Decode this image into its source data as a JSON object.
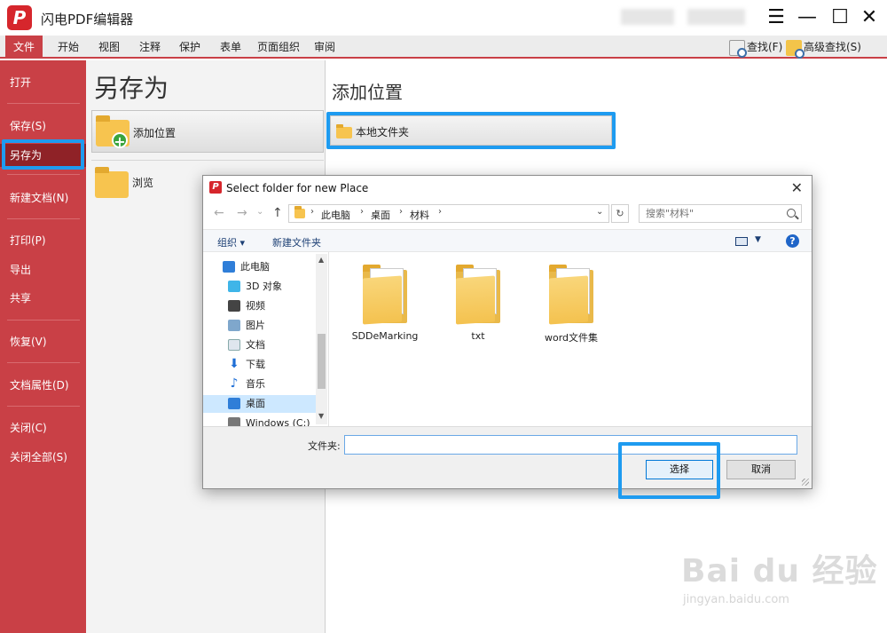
{
  "app": {
    "logo_char": "P",
    "title": "闪电PDF编辑器",
    "accent": "#c94046",
    "highlight": "#1e9bf0"
  },
  "window_controls": {
    "menu_icon": "hamburger-icon",
    "min_glyph": "—",
    "max_glyph": "☐",
    "close_glyph": "✕"
  },
  "ribbon": {
    "tabs": [
      "文件",
      "开始",
      "视图",
      "注释",
      "保护",
      "表单",
      "页面组织",
      "审阅"
    ],
    "active_tab": "文件",
    "find_label": "查找(F)",
    "advanced_find_label": "高级查找(S)"
  },
  "sidebar": {
    "items": [
      "打开",
      "保存(S)",
      "另存为",
      "新建文档(N)",
      "打印(P)",
      "导出",
      "共享",
      "恢复(V)",
      "文档属性(D)",
      "关闭(C)",
      "关闭全部(S)"
    ],
    "active": "另存为"
  },
  "middle": {
    "title": "另存为",
    "add_location_label": "添加位置",
    "browse_label": "浏览"
  },
  "right": {
    "title": "添加位置",
    "local_folder_label": "本地文件夹"
  },
  "dialog": {
    "logo_char": "P",
    "title": "Select folder for new Place",
    "close_glyph": "✕",
    "address": {
      "segments": [
        "此电脑",
        "桌面",
        "材料"
      ]
    },
    "refresh_glyph": "↻",
    "search_placeholder": "搜索\"材料\"",
    "toolbar": {
      "organize_label": "组织 ▾",
      "new_folder_label": "新建文件夹",
      "help_glyph": "?"
    },
    "tree": {
      "items": [
        "此电脑",
        "3D 对象",
        "视频",
        "图片",
        "文档",
        "下载",
        "音乐",
        "桌面",
        "Windows (C:)"
      ],
      "selected": "桌面"
    },
    "files": [
      {
        "name": "SDDeMarking"
      },
      {
        "name": "txt"
      },
      {
        "name": "word文件集"
      }
    ],
    "folder_field_label": "文件夹:",
    "folder_field_value": "",
    "select_button": "选择",
    "cancel_button": "取消"
  },
  "watermark": {
    "main": "Bai du 经验",
    "sub": "jingyan.baidu.com"
  }
}
